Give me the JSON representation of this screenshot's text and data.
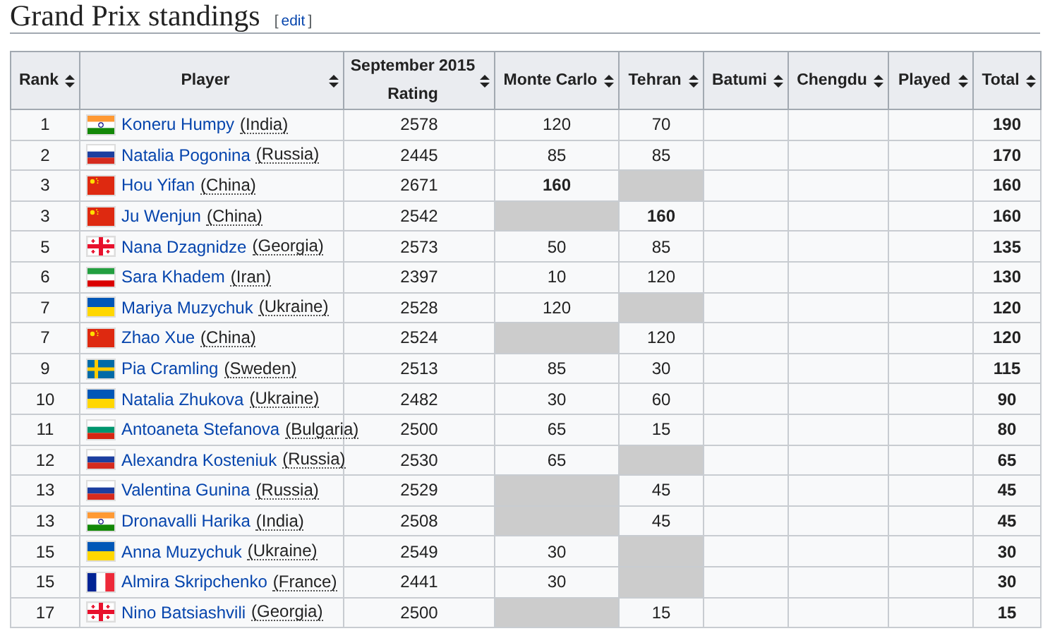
{
  "section": {
    "title": "Grand Prix standings",
    "bracket_open": "[",
    "edit_label": "edit",
    "bracket_close": "]"
  },
  "table": {
    "columns": [
      {
        "label": "Rank",
        "kind": "rank"
      },
      {
        "label": "Player",
        "kind": "player"
      },
      {
        "label": "September 2015 Rating",
        "kind": "rating"
      },
      {
        "label": "Monte Carlo",
        "kind": "event"
      },
      {
        "label": "Tehran",
        "kind": "event"
      },
      {
        "label": "Batumi",
        "kind": "event"
      },
      {
        "label": "Chengdu",
        "kind": "event"
      },
      {
        "label": "Played",
        "kind": "event"
      },
      {
        "label": "Total",
        "kind": "total"
      }
    ],
    "rows": [
      {
        "rank": "1",
        "player": "Koneru Humpy",
        "country": "(India)",
        "kind": "india",
        "rating": "2578",
        "events": [
          {
            "value": "120",
            "absent": false,
            "bold": false
          },
          {
            "value": "70",
            "absent": false,
            "bold": false
          }
        ],
        "total": "190"
      },
      {
        "rank": "2",
        "player": "Natalia Pogonina",
        "country": "(Russia)",
        "kind": "russia",
        "rating": "2445",
        "events": [
          {
            "value": "85",
            "absent": false,
            "bold": false
          },
          {
            "value": "85",
            "absent": false,
            "bold": false
          }
        ],
        "total": "170"
      },
      {
        "rank": "3",
        "player": "Hou Yifan",
        "country": "(China)",
        "kind": "china",
        "rating": "2671",
        "events": [
          {
            "value": "160",
            "absent": false,
            "bold": true
          },
          {
            "absent": true,
            "bold": false
          }
        ],
        "total": "160"
      },
      {
        "rank": "3",
        "player": "Ju Wenjun",
        "country": "(China)",
        "kind": "china",
        "rating": "2542",
        "events": [
          {
            "absent": true,
            "bold": false
          },
          {
            "value": "160",
            "absent": false,
            "bold": true
          }
        ],
        "total": "160"
      },
      {
        "rank": "5",
        "player": "Nana Dzagnidze",
        "country": "(Georgia)",
        "kind": "georgia",
        "rating": "2573",
        "events": [
          {
            "value": "50",
            "absent": false,
            "bold": false
          },
          {
            "value": "85",
            "absent": false,
            "bold": false
          }
        ],
        "total": "135"
      },
      {
        "rank": "6",
        "player": "Sara Khadem",
        "country": "(Iran)",
        "kind": "iran",
        "rating": "2397",
        "events": [
          {
            "value": "10",
            "absent": false,
            "bold": false
          },
          {
            "value": "120",
            "absent": false,
            "bold": false
          }
        ],
        "total": "130"
      },
      {
        "rank": "7",
        "player": "Mariya Muzychuk",
        "country": "(Ukraine)",
        "kind": "ukraine",
        "rating": "2528",
        "events": [
          {
            "value": "120",
            "absent": false,
            "bold": false
          },
          {
            "absent": true,
            "bold": false
          }
        ],
        "total": "120"
      },
      {
        "rank": "7",
        "player": "Zhao Xue",
        "country": "(China)",
        "kind": "china",
        "rating": "2524",
        "events": [
          {
            "absent": true,
            "bold": false
          },
          {
            "value": "120",
            "absent": false,
            "bold": false
          }
        ],
        "total": "120"
      },
      {
        "rank": "9",
        "player": "Pia Cramling",
        "country": "(Sweden)",
        "kind": "sweden",
        "rating": "2513",
        "events": [
          {
            "value": "85",
            "absent": false,
            "bold": false
          },
          {
            "value": "30",
            "absent": false,
            "bold": false
          }
        ],
        "total": "115"
      },
      {
        "rank": "10",
        "player": "Natalia Zhukova",
        "country": "(Ukraine)",
        "kind": "ukraine",
        "rating": "2482",
        "events": [
          {
            "value": "30",
            "absent": false,
            "bold": false
          },
          {
            "value": "60",
            "absent": false,
            "bold": false
          }
        ],
        "total": "90"
      },
      {
        "rank": "11",
        "player": "Antoaneta Stefanova",
        "country": "(Bulgaria)",
        "kind": "bulgaria",
        "rating": "2500",
        "events": [
          {
            "value": "65",
            "absent": false,
            "bold": false
          },
          {
            "value": "15",
            "absent": false,
            "bold": false
          }
        ],
        "total": "80"
      },
      {
        "rank": "12",
        "player": "Alexandra Kosteniuk",
        "country": "(Russia)",
        "kind": "russia",
        "rating": "2530",
        "events": [
          {
            "value": "65",
            "absent": false,
            "bold": false
          },
          {
            "absent": true,
            "bold": false
          }
        ],
        "total": "65"
      },
      {
        "rank": "13",
        "player": "Valentina Gunina",
        "country": "(Russia)",
        "kind": "russia",
        "rating": "2529",
        "events": [
          {
            "absent": true,
            "bold": false
          },
          {
            "value": "45",
            "absent": false,
            "bold": false
          }
        ],
        "total": "45"
      },
      {
        "rank": "13",
        "player": "Dronavalli Harika",
        "country": "(India)",
        "kind": "india",
        "rating": "2508",
        "events": [
          {
            "absent": true,
            "bold": false
          },
          {
            "value": "45",
            "absent": false,
            "bold": false
          }
        ],
        "total": "45"
      },
      {
        "rank": "15",
        "player": "Anna Muzychuk",
        "country": "(Ukraine)",
        "kind": "ukraine",
        "rating": "2549",
        "events": [
          {
            "value": "30",
            "absent": false,
            "bold": false
          },
          {
            "absent": true,
            "bold": false
          }
        ],
        "total": "30"
      },
      {
        "rank": "15",
        "player": "Almira Skripchenko",
        "country": "(France)",
        "kind": "france",
        "rating": "2441",
        "events": [
          {
            "value": "30",
            "absent": false,
            "bold": false
          },
          {
            "absent": true,
            "bold": false
          }
        ],
        "total": "30"
      },
      {
        "rank": "17",
        "player": "Nino Batsiashvili",
        "country": "(Georgia)",
        "kind": "georgia",
        "rating": "2500",
        "events": [
          {
            "absent": true,
            "bold": false
          },
          {
            "value": "15",
            "absent": false,
            "bold": false
          }
        ],
        "total": "15"
      }
    ]
  }
}
